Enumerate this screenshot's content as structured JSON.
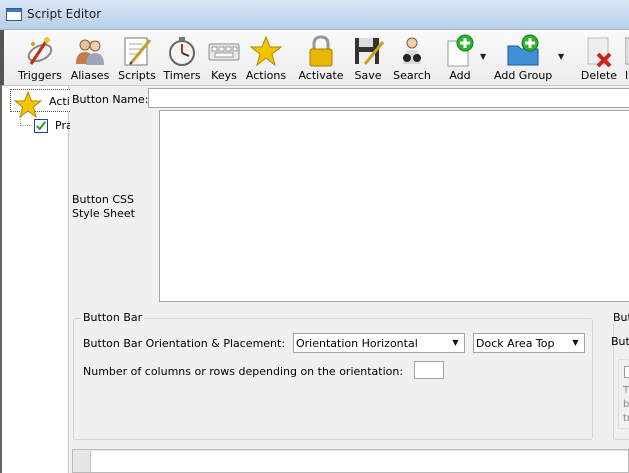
{
  "window": {
    "title": "Script Editor"
  },
  "toolbar": {
    "items": [
      {
        "label": "Triggers",
        "icon": "triggers-icon"
      },
      {
        "label": "Aliases",
        "icon": "aliases-icon"
      },
      {
        "label": "Scripts",
        "icon": "scripts-icon"
      },
      {
        "label": "Timers",
        "icon": "timers-icon"
      },
      {
        "label": "Keys",
        "icon": "keys-icon"
      },
      {
        "label": "Actions",
        "icon": "actions-star-icon"
      },
      {
        "label": "Activate",
        "icon": "lock-icon"
      },
      {
        "label": "Save",
        "icon": "save-disk-icon"
      },
      {
        "label": "Search",
        "icon": "search-binoculars-icon"
      },
      {
        "label": "Add",
        "icon": "add-item-icon"
      },
      {
        "label": "Add Group",
        "icon": "add-group-folder-icon"
      },
      {
        "label": "Delete",
        "icon": "delete-icon"
      },
      {
        "label": "I",
        "icon": "partial-icon"
      }
    ]
  },
  "tree": {
    "root_label": "Acti",
    "child_label": "Pra"
  },
  "form": {
    "button_name_label": "Button Name:",
    "button_name_value": "",
    "css_label_line1": "Button CSS",
    "css_label_line2": "Style Sheet",
    "css_value": "",
    "button_bar": {
      "title": "Button Bar",
      "orientation_label": "Button Bar Orientation & Placement:",
      "orientation_value": "Orientation Horizontal",
      "dock_value": "Dock Area Top",
      "columns_label": "Number of columns or rows depending on the orientation:",
      "columns_value": ""
    },
    "right_group": {
      "title": "Butt",
      "label": "Butt",
      "text_line1": "Th",
      "text_line2": "be",
      "text_line3": "tr"
    }
  },
  "colors": {
    "titlebar": "#c5d8ee",
    "accent_blue": "#3a78c2",
    "star_yellow": "#f5c400",
    "add_green": "#2db52d"
  }
}
